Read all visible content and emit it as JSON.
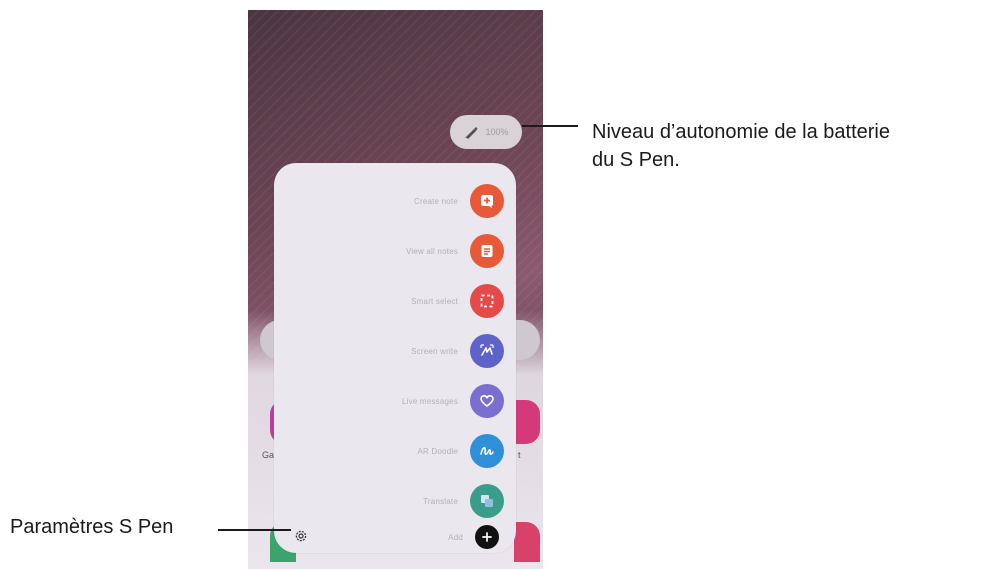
{
  "battery": {
    "level_text": "100%",
    "icon": "s-pen-icon"
  },
  "panel": {
    "items": [
      {
        "label": "Create note",
        "icon": "create-note-icon",
        "color": "#e8593a"
      },
      {
        "label": "View all notes",
        "icon": "view-notes-icon",
        "color": "#e8593a"
      },
      {
        "label": "Smart select",
        "icon": "smart-select-icon",
        "color": "#e44a4a"
      },
      {
        "label": "Screen write",
        "icon": "screen-write-icon",
        "color": "#5f63c9"
      },
      {
        "label": "Live messages",
        "icon": "live-messages-icon",
        "color": "#7a6fd1"
      },
      {
        "label": "AR Doodle",
        "icon": "ar-doodle-icon",
        "color": "#2f8fd8"
      },
      {
        "label": "Translate",
        "icon": "translate-icon",
        "color": "#3a9d8a"
      },
      {
        "label": "Add",
        "icon": "add-icon",
        "color": "#111111"
      }
    ],
    "settings_icon": "gear-icon"
  },
  "background_apps": {
    "left_label": "Ga",
    "right_label": "t"
  },
  "callouts": {
    "battery_line1": "Niveau d’autonomie de la batterie",
    "battery_line2": "du S Pen.",
    "settings": "Paramètres S Pen"
  }
}
